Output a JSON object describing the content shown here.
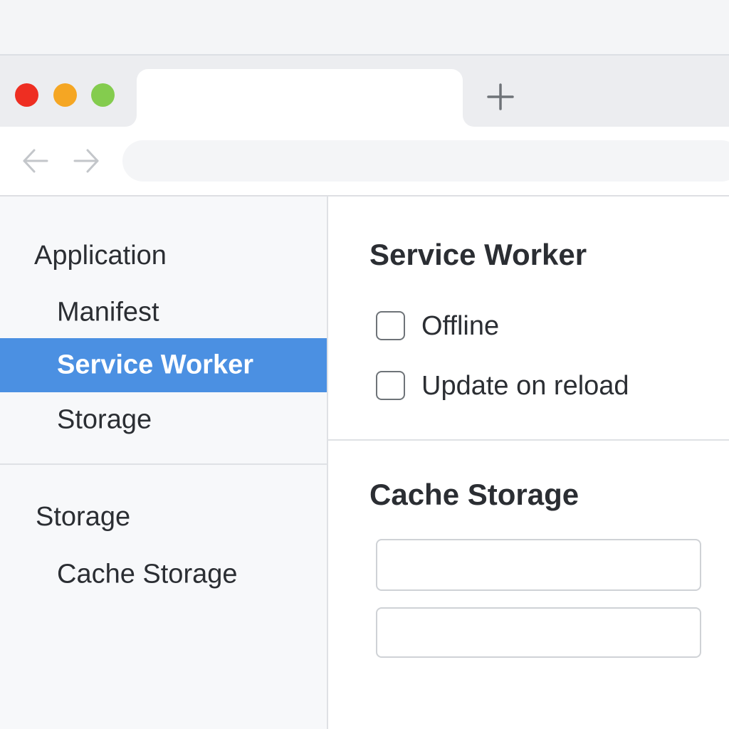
{
  "window": {
    "controls": [
      "close",
      "minimize",
      "maximize"
    ],
    "colors": {
      "close": "#ee2e22",
      "minimize": "#f5a623",
      "maximize": "#84cc4e"
    }
  },
  "tabs": {
    "active_tab_title": "",
    "new_tab_icon": "plus-icon"
  },
  "toolbar": {
    "back_icon": "arrow-left-icon",
    "forward_icon": "arrow-right-icon",
    "address": "",
    "address_placeholder": ""
  },
  "sidebar": {
    "application_title": "Application",
    "application_items": [
      {
        "label": "Manifest",
        "selected": false
      },
      {
        "label": "Service Worker",
        "selected": true
      },
      {
        "label": "Storage",
        "selected": false
      }
    ],
    "storage_title": "Storage",
    "storage_items": [
      {
        "label": "Cache Storage",
        "selected": false
      }
    ],
    "selected_color": "#4b90e2"
  },
  "service_worker": {
    "heading": "Service Worker",
    "options": [
      {
        "label": "Offline",
        "checked": false
      },
      {
        "label": "Update on reload",
        "checked": false
      }
    ]
  },
  "cache_storage": {
    "heading": "Cache Storage",
    "entries": [
      "",
      ""
    ]
  }
}
